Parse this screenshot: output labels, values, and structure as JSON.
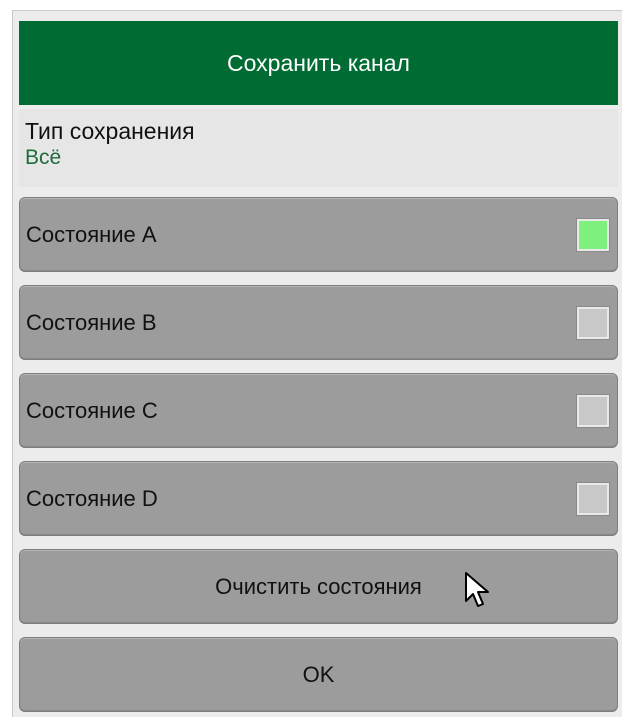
{
  "dialog": {
    "title": "Сохранить канал",
    "save_type": {
      "label": "Тип сохранения",
      "value": "Всё"
    },
    "states": [
      {
        "label": "Состояние A",
        "active": true
      },
      {
        "label": "Состояние B",
        "active": false
      },
      {
        "label": "Состояние C",
        "active": false
      },
      {
        "label": "Состояние D",
        "active": false
      }
    ],
    "clear_label": "Очистить состояния",
    "ok_label": "OK"
  },
  "colors": {
    "title_bg": "#006b33",
    "active_indicator": "#7ef07e",
    "inactive_indicator": "#c8c8c8",
    "button_bg": "#9c9c9c",
    "value_text": "#1f6b3b"
  },
  "cursor": {
    "icon": "mouse-pointer-icon"
  }
}
